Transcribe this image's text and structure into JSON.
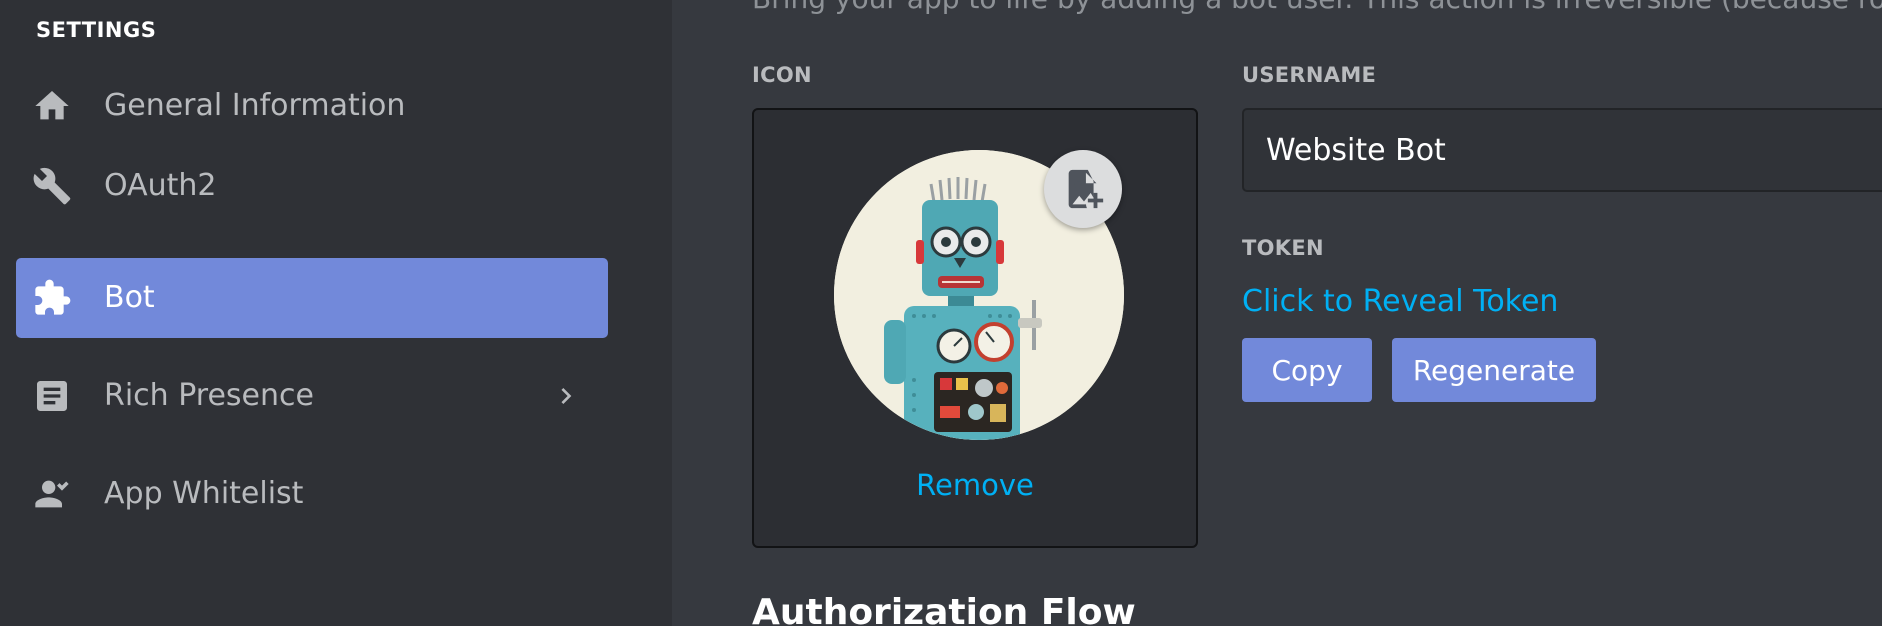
{
  "sidebar": {
    "heading": "SETTINGS",
    "items": [
      {
        "label": "General Information",
        "icon": "home-icon",
        "selected": false
      },
      {
        "label": "OAuth2",
        "icon": "wrench-icon",
        "selected": false
      },
      {
        "label": "Bot",
        "icon": "puzzle-icon",
        "selected": true
      },
      {
        "label": "Rich Presence",
        "icon": "document-icon",
        "selected": false,
        "expandable": true
      },
      {
        "label": "App Whitelist",
        "icon": "person-icon",
        "selected": false
      }
    ]
  },
  "main": {
    "intro_text": "Bring your app to life by adding a bot user. This action is irreversible (because robots are too cool to destroy).",
    "icon_section": {
      "label": "ICON",
      "remove_label": "Remove"
    },
    "username": {
      "label": "USERNAME",
      "value": "Website Bot"
    },
    "token": {
      "label": "TOKEN",
      "reveal_label": "Click to Reveal Token",
      "copy_label": "Copy",
      "regenerate_label": "Regenerate"
    },
    "section_title": "Authorization Flow"
  },
  "colors": {
    "sidebar_bg": "#2f3136",
    "main_bg": "#36393f",
    "accent": "#7289da",
    "link": "#00b0f4"
  }
}
